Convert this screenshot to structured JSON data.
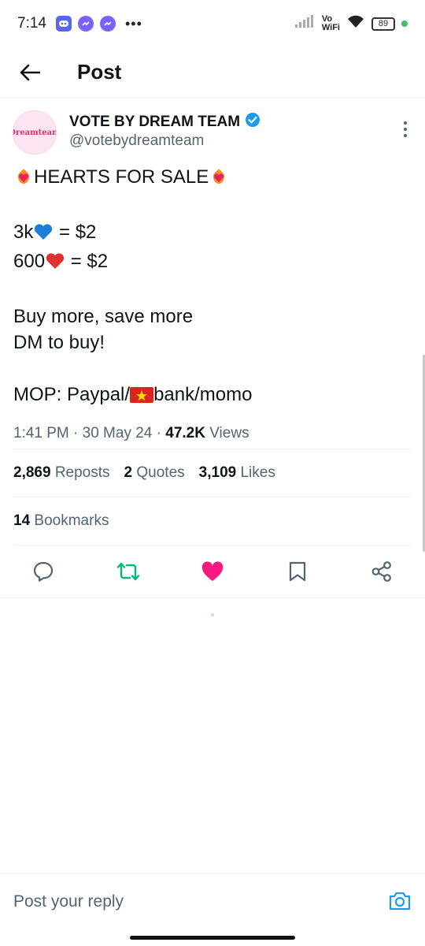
{
  "status_bar": {
    "time": "7:14",
    "more": "•••",
    "network_label_1": "Vo",
    "network_label_2": "WiFi",
    "battery": "89"
  },
  "header": {
    "title": "Post"
  },
  "tweet": {
    "author_name": "VOTE BY DREAM TEAM",
    "author_handle": "@votebydreamteam",
    "avatar_text": "Dreamteam",
    "line1": "HEARTS FOR SALE",
    "line2_prefix": "3k",
    "line2_suffix": " = $2",
    "line3_prefix": "600",
    "line3_suffix": " = $2",
    "line4": "Buy more, save more",
    "line5": "DM to buy!",
    "line6_prefix": "MOP: Paypal/",
    "line6_suffix": "bank/momo",
    "time": "1:41 PM · 30 May 24 · ",
    "views_count": "47.2K",
    "views_label": " Views"
  },
  "stats": {
    "reposts_count": "2,869",
    "reposts_label": "Reposts",
    "quotes_count": "2",
    "quotes_label": "Quotes",
    "likes_count": "3,109",
    "likes_label": "Likes",
    "bookmarks_count": "14",
    "bookmarks_label": "Bookmarks"
  },
  "reply": {
    "placeholder": "Post your reply"
  },
  "colors": {
    "verified": "#1d9bf0",
    "retweet_active": "#00ba7c",
    "like_active": "#f91880",
    "text_secondary": "#536471"
  }
}
